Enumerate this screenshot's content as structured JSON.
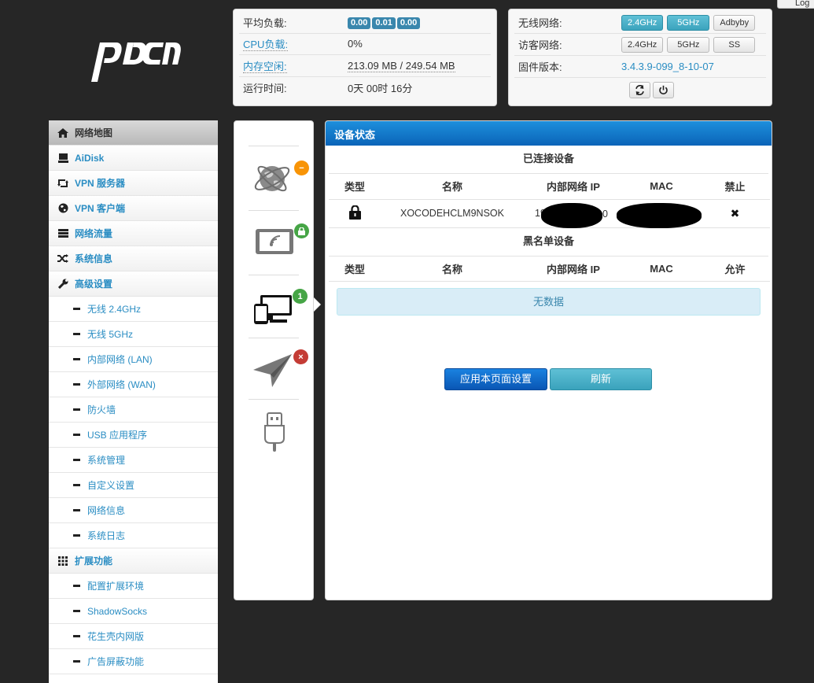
{
  "topbar": {
    "logout_label": "Log"
  },
  "logo": {
    "text": "pdcn"
  },
  "status": {
    "load_label": "平均负载:",
    "load_values": [
      "0.00",
      "0.01",
      "0.00"
    ],
    "cpu_label": "CPU负载:",
    "cpu_value": "0%",
    "mem_label": "内存空闲:",
    "mem_value": "213.09 MB / 249.54 MB",
    "uptime_label": "运行时间:",
    "uptime_value": "0天 00时 16分"
  },
  "radio": {
    "wireless_label": "无线网络:",
    "wireless_buttons": [
      "2.4GHz",
      "5GHz",
      "Adbyby"
    ],
    "guest_label": "访客网络:",
    "guest_buttons": [
      "2.4GHz",
      "5GHz",
      "SS"
    ],
    "firmware_label": "固件版本:",
    "firmware_value": "3.4.3.9-099_8-10-07",
    "refresh_icon": "refresh-icon",
    "power_icon": "power-icon"
  },
  "sidebar": {
    "items": [
      {
        "label": "网络地图",
        "icon": "home-icon"
      },
      {
        "label": "AiDisk",
        "icon": "hdd-icon"
      },
      {
        "label": "VPN 服务器",
        "icon": "retweet-icon"
      },
      {
        "label": "VPN 客户端",
        "icon": "globe-icon"
      },
      {
        "label": "网络流量",
        "icon": "tasks-icon"
      },
      {
        "label": "系统信息",
        "icon": "random-icon"
      },
      {
        "label": "高级设置",
        "icon": "wrench-icon"
      }
    ],
    "advanced_sub": [
      "无线 2.4GHz",
      "无线 5GHz",
      "内部网络 (LAN)",
      "外部网络 (WAN)",
      "防火墙",
      "USB 应用程序",
      "系统管理",
      "自定义设置",
      "网络信息",
      "系统日志"
    ],
    "ext_label": "扩展功能",
    "ext_icon": "grid-icon",
    "ext_sub": [
      "配置扩展环境",
      "ShadowSocks",
      "花生壳内网版",
      "广告屏蔽功能"
    ]
  },
  "icons": {
    "internet_badge": "−",
    "wireless_badge": "lock",
    "clients_badge": "1",
    "usb_badge": "×"
  },
  "main": {
    "title": "设备状态",
    "connected_title": "已连接设备",
    "columns": [
      "类型",
      "名称",
      "内部网络 IP",
      "MAC",
      "禁止"
    ],
    "devices": [
      {
        "name": "XOCODEHCLM9NSOK",
        "ip_visible": "192.",
        "ip_tail": "0",
        "mac_visible": ""
      }
    ],
    "blacklist_title": "黑名单设备",
    "blacklist_columns": [
      "类型",
      "名称",
      "内部网络 IP",
      "MAC",
      "允许"
    ],
    "no_data": "无数据",
    "apply_label": "应用本页面设置",
    "refresh_label": "刷新"
  }
}
